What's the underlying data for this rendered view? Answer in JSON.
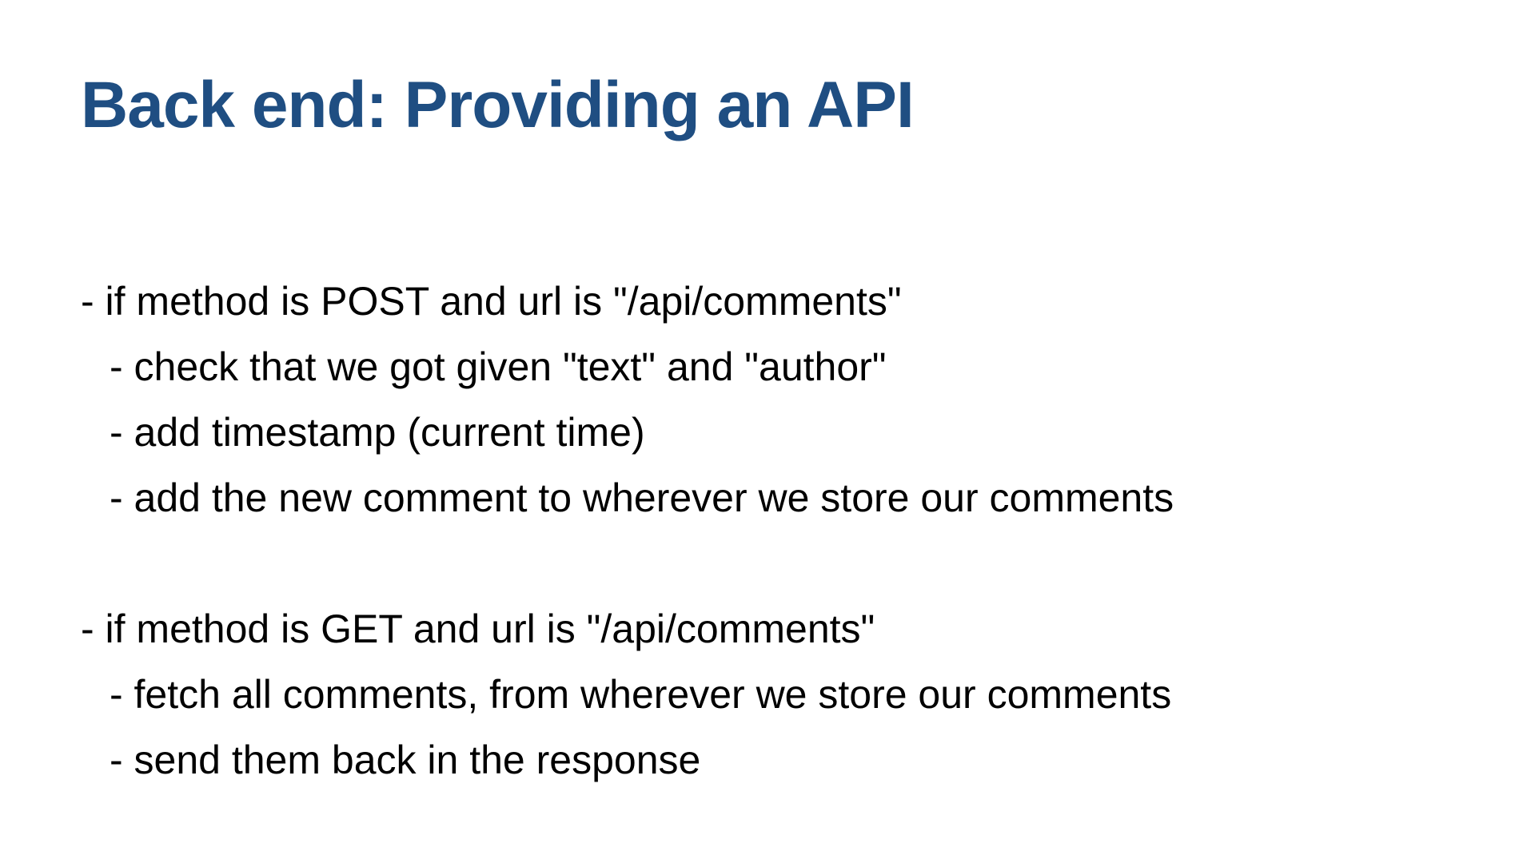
{
  "slide": {
    "title": "Back end: Providing an API",
    "sections": [
      {
        "heading": "- if method is POST and url is \"/api/comments\"",
        "items": [
          "- check that we got given \"text\" and \"author\"",
          "- add timestamp (current time)",
          "- add the new comment to wherever we store our comments"
        ]
      },
      {
        "heading": "- if method is GET and url is \"/api/comments\"",
        "items": [
          "- fetch all comments, from wherever we store our comments",
          "- send them back in the response"
        ]
      }
    ]
  },
  "colors": {
    "title": "#1f4e82",
    "text": "#000000",
    "background": "#ffffff"
  }
}
